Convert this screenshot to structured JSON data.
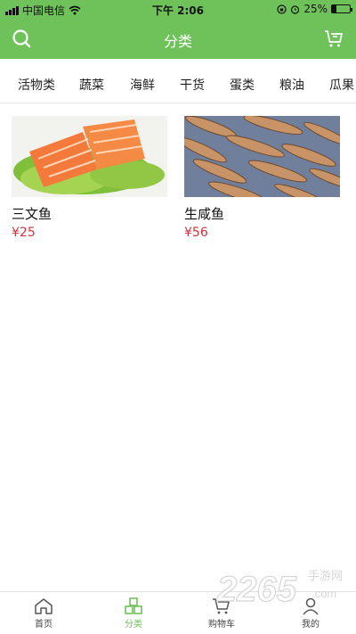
{
  "status_bar": {
    "carrier": "中国电信",
    "time": "下午 2:06",
    "battery": "25%",
    "battery_level": 0.25
  },
  "header": {
    "title": "分类",
    "left_icon": "search-icon",
    "right_icon": "cart-icon"
  },
  "tabs": [
    {
      "label": "活物类",
      "active": true
    },
    {
      "label": "蔬菜"
    },
    {
      "label": "海鲜"
    },
    {
      "label": "干货"
    },
    {
      "label": "蛋类"
    },
    {
      "label": "粮油"
    },
    {
      "label": "瓜果"
    }
  ],
  "products": [
    {
      "name": "三文鱼",
      "price": "¥25",
      "image": "salmon-slices"
    },
    {
      "name": "生咸鱼",
      "price": "¥56",
      "image": "salted-fish"
    }
  ],
  "tabbar": [
    {
      "label": "首页",
      "icon": "home-icon"
    },
    {
      "label": "分类",
      "icon": "category-icon",
      "active": true
    },
    {
      "label": "购物车",
      "icon": "cart-icon"
    },
    {
      "label": "我的",
      "icon": "user-icon"
    }
  ],
  "watermark": {
    "text": "2265",
    "sub": "手游网",
    "url": ".com"
  },
  "colors": {
    "accent": "#6fc25a",
    "price": "#d0323a"
  }
}
